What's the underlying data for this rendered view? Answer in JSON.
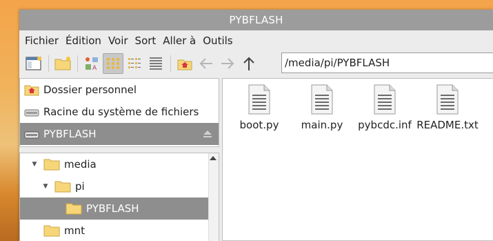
{
  "window": {
    "title": "PYBFLASH"
  },
  "menu": [
    "Fichier",
    "Édition",
    "Voir",
    "Sort",
    "Aller à",
    "Outils"
  ],
  "toolbar": {
    "path": "/media/pi/PYBFLASH",
    "icons": [
      "new-window-icon",
      "new-folder-icon",
      "thumbnail-view-icon",
      "icon-view-icon",
      "compact-view-icon",
      "list-view-icon",
      "home-icon",
      "back-arrow-icon",
      "forward-arrow-icon",
      "up-arrow-icon"
    ]
  },
  "places": [
    {
      "label": "Dossier personnel",
      "icon": "home-folder-icon"
    },
    {
      "label": "Racine du système de fichiers",
      "icon": "drive-icon"
    },
    {
      "label": "PYBFLASH",
      "icon": "usb-drive-icon",
      "selected": true
    }
  ],
  "tree": [
    {
      "label": "media",
      "expanded": true
    },
    {
      "label": "pi",
      "expanded": true
    },
    {
      "label": "PYBFLASH",
      "selected": true
    },
    {
      "label": "mnt"
    }
  ],
  "files": [
    {
      "name": "boot.py"
    },
    {
      "name": "main.py"
    },
    {
      "name": "pybcdc.inf"
    },
    {
      "name": "README.txt"
    }
  ],
  "colors": {
    "titlebar": "#9c9c9c",
    "selection": "#8e8e8e",
    "folder": "#f7d67a",
    "home": "#d9363e"
  }
}
